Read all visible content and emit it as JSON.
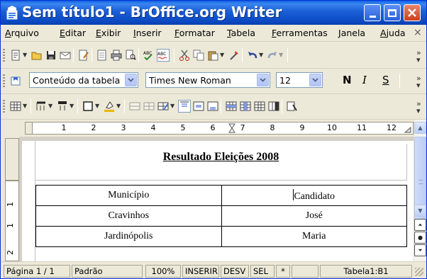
{
  "window": {
    "title": "Sem título1 - BrOffice.org Writer"
  },
  "menubar": {
    "items": [
      "Arquivo",
      "Editar",
      "Exibir",
      "Inserir",
      "Formatar",
      "Tabela",
      "Ferramentas",
      "Janela",
      "Ajuda"
    ],
    "close_label": "×"
  },
  "formatting": {
    "style": "Conteúdo da tabela",
    "font": "Times New Roman",
    "size": "12",
    "bold": "N",
    "italic": "I",
    "underline": "S"
  },
  "ruler": {
    "labels": [
      "1",
      "2",
      "3",
      "4",
      "5",
      "6",
      "7",
      "8",
      "9",
      "10",
      "11",
      "12"
    ]
  },
  "vruler": {
    "labels": [
      "1",
      "1",
      "2"
    ]
  },
  "document": {
    "title": "Resultado Eleições 2008",
    "table": {
      "rows": [
        [
          "Município",
          "Candidato"
        ],
        [
          "Cravinhos",
          "José"
        ],
        [
          "Jardinópolis",
          "Maria"
        ]
      ]
    }
  },
  "statusbar": {
    "page": "Página 1 / 1",
    "style": "Padrão",
    "zoom": "100%",
    "insert_mode": "INSERIR",
    "selection_mode": "DESV",
    "sel": "SEL",
    "modified": "*",
    "cell": "Tabela1:B1"
  },
  "icons": {
    "app": "writer-document-icon",
    "accent": "#0a5fe0"
  }
}
